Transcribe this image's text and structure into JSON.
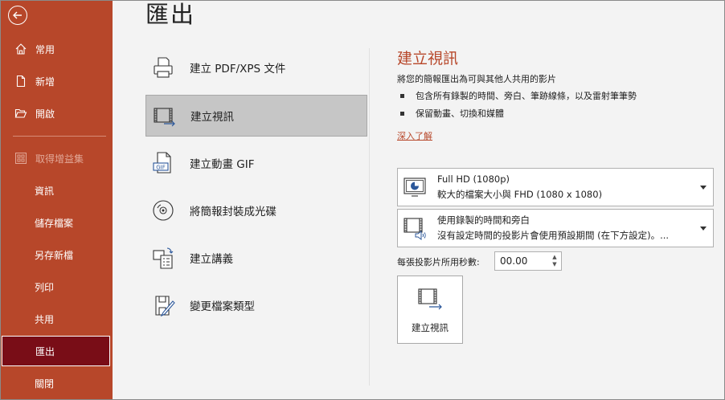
{
  "sidebar": {
    "items": [
      {
        "label": "常用"
      },
      {
        "label": "新增"
      },
      {
        "label": "開啟"
      },
      {
        "label": "取得增益集"
      },
      {
        "label": "資訊"
      },
      {
        "label": "儲存檔案"
      },
      {
        "label": "另存新檔"
      },
      {
        "label": "列印"
      },
      {
        "label": "共用"
      },
      {
        "label": "匯出"
      },
      {
        "label": "關閉"
      }
    ]
  },
  "header": {
    "title": "匯出"
  },
  "options": [
    {
      "label": "建立 PDF/XPS 文件"
    },
    {
      "label": "建立視訊"
    },
    {
      "label": "建立動畫 GIF"
    },
    {
      "label": "將簡報封裝成光碟"
    },
    {
      "label": "建立講義"
    },
    {
      "label": "變更檔案類型"
    }
  ],
  "detail": {
    "title": "建立視訊",
    "description": "將您的簡報匯出為可與其他人共用的影片",
    "bullets": [
      "包含所有錄製的時間、旁白、筆跡線條，以及雷射筆筆勢",
      "保留動畫、切換和媒體"
    ],
    "learn_more": "深入了解",
    "quality": {
      "main": "Full HD (1080p)",
      "sub": "較大的檔案大小與 FHD (1080 x 1080)"
    },
    "timing": {
      "main": "使用錄製的時間和旁白",
      "sub": "沒有設定時間的投影片會使用預設期間 (在下方設定)。..."
    },
    "seconds_label": "每張投影片所用秒數:",
    "seconds_value": "00.00",
    "button_label": "建立視訊"
  },
  "colors": {
    "accent": "#b7472a",
    "active": "#790d17"
  }
}
